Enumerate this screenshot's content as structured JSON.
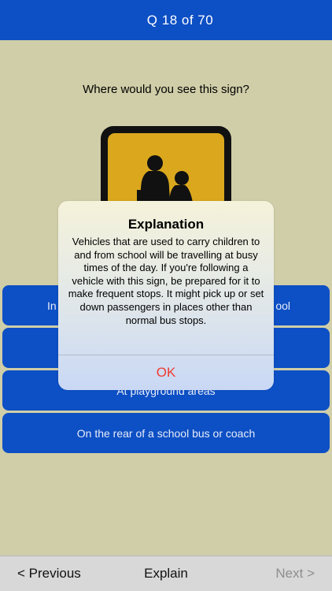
{
  "header": {
    "title": "Q 18  of   70"
  },
  "question": {
    "text": "Where would you see this sign?"
  },
  "sign": {
    "icon": "school-children-sign-icon",
    "background_color": "#dba81d",
    "border_color": "#111111"
  },
  "answers": [
    {
      "label_left": "In",
      "label_right": "ool"
    },
    {
      "label": ""
    },
    {
      "label": "At playground areas"
    },
    {
      "label": "On the rear of a school bus or coach"
    }
  ],
  "modal": {
    "title": "Explanation",
    "body": "Vehicles that are used to carry children to and from school will be travelling at busy times of the day. If you're following a vehicle with this sign, be prepared for it to make frequent stops. It might pick up or set down passengers in places other than normal bus stops.",
    "ok_label": "OK"
  },
  "footer": {
    "previous_label": "< Previous",
    "explain_label": "Explain",
    "next_label": "Next >"
  },
  "colors": {
    "accent": "#0d4fc4",
    "background": "#d0cea8",
    "ok": "#f03a2e",
    "disabled": "#8e8e8e"
  }
}
